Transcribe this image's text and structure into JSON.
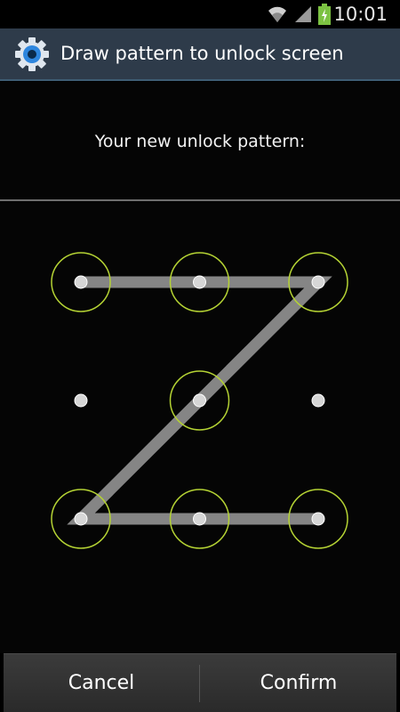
{
  "status_bar": {
    "time": "10:01",
    "icons": [
      "wifi-icon",
      "signal-icon",
      "battery-charging-icon"
    ],
    "battery_color": "#7cc242"
  },
  "title_bar": {
    "title": "Draw pattern to unlock screen",
    "icon": "settings-gear-icon",
    "accent": "#2e86de",
    "background": "#2e3b4a"
  },
  "header": {
    "prompt": "Your new unlock pattern:"
  },
  "pattern": {
    "grid_size": 3,
    "sequence": [
      0,
      1,
      2,
      4,
      6,
      7,
      8
    ],
    "ring_color": "#b5d334",
    "line_color": "#8c8c8c"
  },
  "buttons": {
    "cancel_label": "Cancel",
    "confirm_label": "Confirm"
  }
}
